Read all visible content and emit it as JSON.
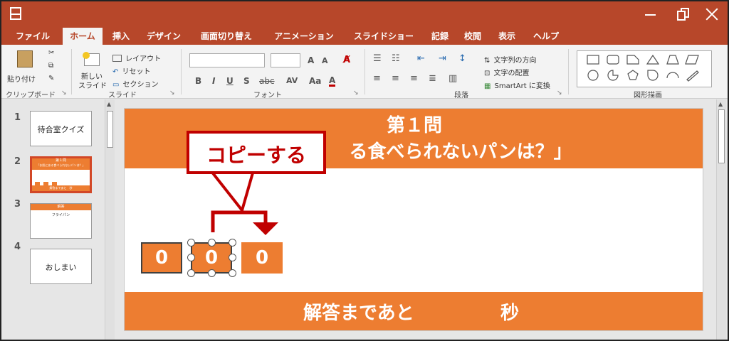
{
  "ribbon_tabs": [
    "ファイル",
    "ホーム",
    "挿入",
    "デザイン",
    "画面切り替え",
    "アニメーション",
    "スライドショー",
    "記録",
    "校閲",
    "表示",
    "ヘルプ"
  ],
  "active_tab": "ホーム",
  "clipboard": {
    "paste": "貼り付け",
    "group": "クリップボード"
  },
  "slides_group": {
    "new_slide_l1": "新しい",
    "new_slide_l2": "スライド",
    "layout": "レイアウト",
    "reset": "リセット",
    "section": "セクション",
    "group": "スライド"
  },
  "font_group": {
    "bold": "B",
    "italic": "I",
    "underline": "U",
    "shadow": "S",
    "strike": "abc",
    "spacing": "AV",
    "grow": "A",
    "shrink": "A",
    "group": "フォント"
  },
  "paragraph_group": {
    "text_direction": "文字列の方向",
    "align_text": "文字の配置",
    "smartart": "SmartArt に変換",
    "group": "段落"
  },
  "drawing_group": {
    "group": "図形描画"
  },
  "thumbnails": [
    {
      "num": "1",
      "text": "待合室クイズ"
    },
    {
      "num": "2",
      "text": ""
    },
    {
      "num": "3",
      "text": ""
    },
    {
      "num": "4",
      "text": "おしまい"
    }
  ],
  "thumb2": {
    "title": "第１問",
    "question": "「お肌にある食べられないパンは？」",
    "footer": "解答まであと　秒"
  },
  "thumb3": {
    "title": "解答",
    "answer": "フライパン"
  },
  "slide": {
    "title_line1": "第１問",
    "title_line2": "る食べられないパンは？」",
    "footer_left": "解答まであと",
    "footer_right": "秒",
    "digits": [
      "0",
      "0",
      "0"
    ]
  },
  "callout": {
    "text": "コピーする"
  },
  "colors": {
    "brand": "#b7472a",
    "accent": "#ed7d31",
    "callout": "#c00000"
  }
}
